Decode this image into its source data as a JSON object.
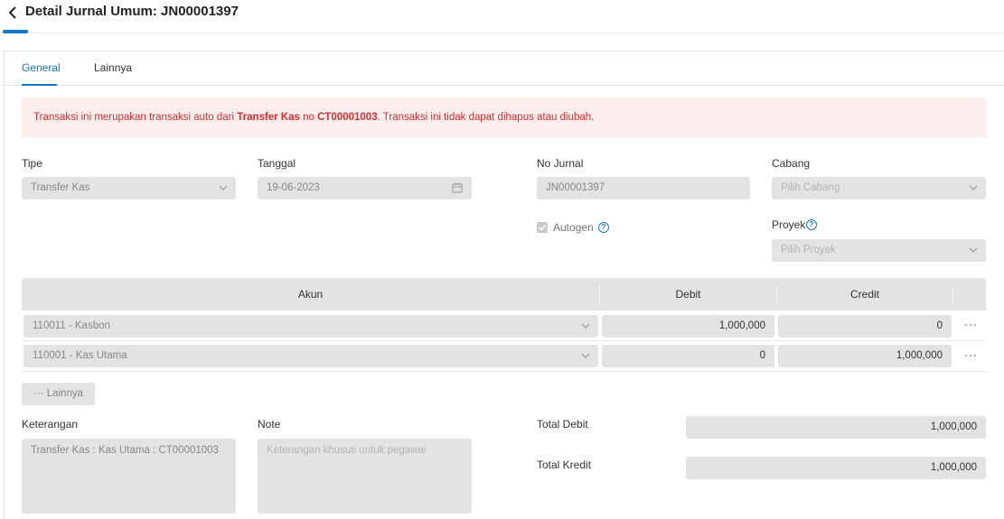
{
  "header": {
    "title": "Detail Jurnal Umum: JN00001397"
  },
  "tabs": [
    {
      "label": "General"
    },
    {
      "label": "Lainnya"
    }
  ],
  "alert": {
    "prefix": "Transaksi ini merupakan transaksi auto dari ",
    "source": "Transfer Kas",
    "mid": " no ",
    "number": "CT00001003",
    "suffix": ". Transaksi ini tidak dapat dihapus atau diubah."
  },
  "form": {
    "tipe": {
      "label": "Tipe",
      "value": "Transfer Kas"
    },
    "tanggal": {
      "label": "Tanggal",
      "value": "19-06-2023"
    },
    "no_jurnal": {
      "label": "No Jurnal",
      "value": "JN00001397"
    },
    "cabang": {
      "label": "Cabang",
      "placeholder": "Pilih Cabang"
    },
    "autogen": {
      "label": "Autogen",
      "checked": true
    },
    "proyek": {
      "label": "Proyek",
      "placeholder": "Pilih Proyek"
    }
  },
  "table": {
    "headers": {
      "akun": "Akun",
      "debit": "Debit",
      "credit": "Credit"
    },
    "rows": [
      {
        "akun": "110011 - Kasbon",
        "debit": "1,000,000",
        "credit": "0"
      },
      {
        "akun": "110001 - Kas Utama",
        "debit": "0",
        "credit": "1,000,000"
      }
    ]
  },
  "more_button": {
    "label": "Lainnya"
  },
  "footer": {
    "keterangan": {
      "label": "Keterangan",
      "value": "Transfer Kas : Kas Utama : CT00001003"
    },
    "note": {
      "label": "Note",
      "placeholder": "Keterangan khusus untuk pegawai"
    },
    "total_debit": {
      "label": "Total Debit",
      "value": "1,000,000"
    },
    "total_kredit": {
      "label": "Total Kredit",
      "value": "1,000,000"
    }
  },
  "colors": {
    "accent": "#1677c8",
    "alert_bg": "#fdeeee",
    "alert_text": "#d92b2b",
    "field_bg": "#e3e3e3"
  },
  "icons": [
    "back-chevron-icon",
    "chevron-down-icon",
    "calendar-icon",
    "help-icon",
    "check-icon",
    "more-horizontal-icon"
  ]
}
